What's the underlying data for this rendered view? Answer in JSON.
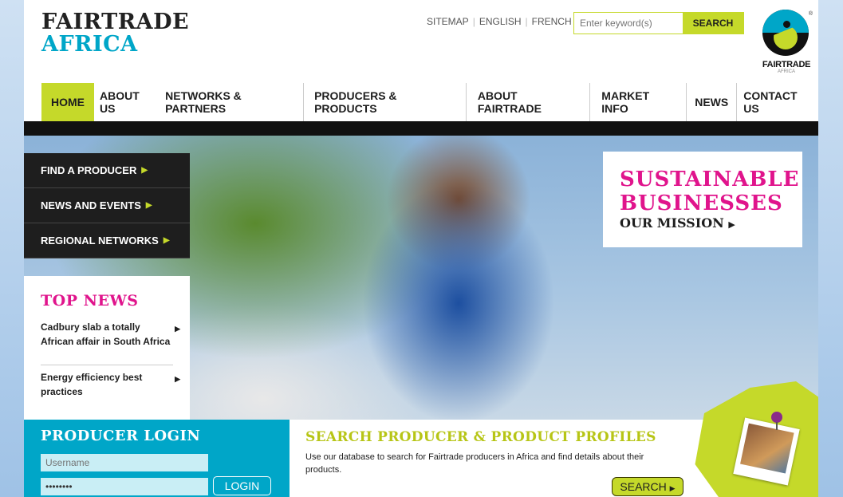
{
  "logo": {
    "line1": "FAIRTRADE",
    "line2": "AFRICA"
  },
  "toplinks": [
    "SITEMAP",
    "ENGLISH",
    "FRENCH"
  ],
  "search": {
    "placeholder": "Enter keyword(s)",
    "button": "SEARCH"
  },
  "mark": {
    "word": "FAIRTRADE",
    "sub": "AFRICA",
    "reg": "®"
  },
  "nav": [
    "HOME",
    "ABOUT US",
    "NETWORKS & PARTNERS",
    "PRODUCERS & PRODUCTS",
    "ABOUT FAIRTRADE",
    "MARKET INFO",
    "NEWS",
    "CONTACT US"
  ],
  "sidemenu": [
    "FIND A PRODUCER",
    "NEWS AND EVENTS",
    "REGIONAL NETWORKS"
  ],
  "topnews": {
    "title": "TOP NEWS",
    "items": [
      "Cadbury slab a totally African affair in South Africa",
      "Energy efficiency best practices"
    ]
  },
  "mission": {
    "line1": "SUSTAINABLE",
    "line2": "BUSINESSES",
    "link": "OUR MISSION"
  },
  "login": {
    "title": "PRODUCER LOGIN",
    "username_placeholder": "Username",
    "password_value": "••••••••",
    "button": "LOGIN"
  },
  "producer_search": {
    "title": "SEARCH PRODUCER & PRODUCT PROFILES",
    "text": "Use our database to search for Fairtrade producers in Africa and find details about their products.",
    "button": "SEARCH"
  },
  "colors": {
    "lime": "#c5d92a",
    "cyan": "#00a6c8",
    "magenta": "#e0148c",
    "dark": "#1e1e1e"
  }
}
